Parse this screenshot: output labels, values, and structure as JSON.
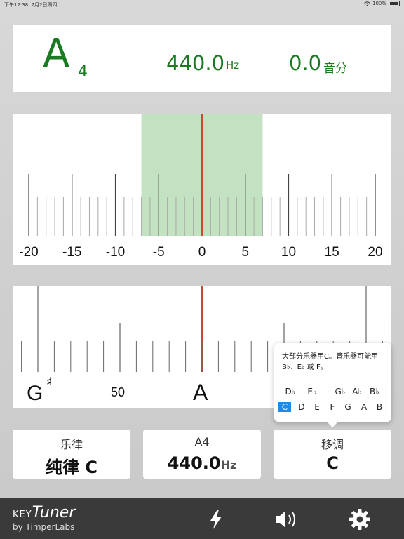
{
  "status_bar": {
    "time": "下午12:38",
    "date": "7月2日周四",
    "battery": "100%",
    "wifi_icon": "wifi-icon"
  },
  "reading": {
    "note": "A",
    "octave": "4",
    "frequency": "440.0",
    "frequency_unit": "Hz",
    "cents": "0.0",
    "cents_unit": "音分"
  },
  "meter": {
    "scale_labels": [
      "-20",
      "-15",
      "-10",
      "-5",
      "0",
      "5",
      "10",
      "15",
      "20"
    ],
    "in_tune_range": [
      -7,
      7
    ],
    "needle_value": 0,
    "colors": {
      "in_tune_zone": "#c2e2c2",
      "needle": "#d0462f"
    }
  },
  "strip": {
    "left_note": "G",
    "left_accidental": "♯",
    "mid_label": "50",
    "center_note": "A"
  },
  "popover": {
    "message": "大部分乐器用C。管乐器可能用B♭、E♭ 或 F。",
    "flats": [
      "D♭",
      "E♭",
      "",
      "G♭",
      "A♭",
      "B♭"
    ],
    "naturals": [
      "C",
      "D",
      "E",
      "F",
      "G",
      "A",
      "B"
    ],
    "selected": "C"
  },
  "modes": [
    {
      "label": "乐律",
      "value": "纯律 C",
      "unit": ""
    },
    {
      "label": "A4",
      "value": "440.0",
      "unit": "Hz"
    },
    {
      "label": "移调",
      "value": "C",
      "unit": ""
    }
  ],
  "bottom_bar": {
    "brand_prefix": "KEY",
    "brand": "Tuner",
    "byline": "by TimperLabs",
    "buttons": [
      "flash-icon",
      "speaker-icon",
      "gear-icon"
    ]
  },
  "accent_color": "#1a7a22"
}
